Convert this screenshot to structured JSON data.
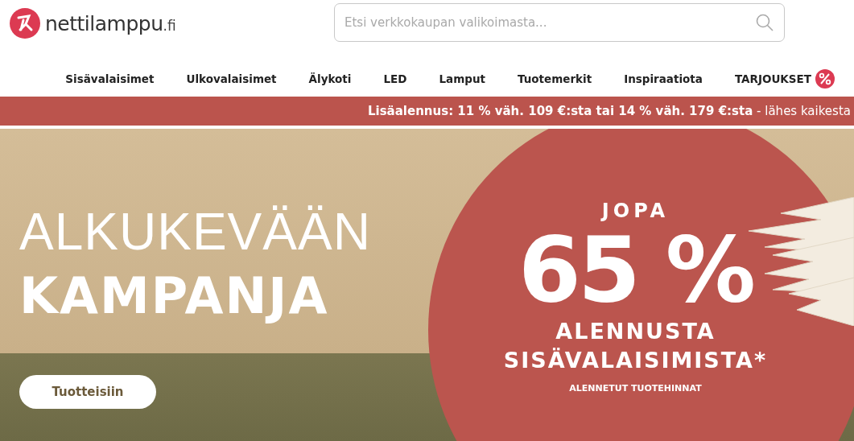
{
  "header": {
    "logo": {
      "name": "nettilamppu",
      "suffix": ".fi"
    },
    "search": {
      "placeholder": "Etsi verkkokaupan valikoimasta..."
    }
  },
  "nav": [
    {
      "label": "Sisävalaisimet",
      "kind": "link"
    },
    {
      "label": "Ulkovalaisimet",
      "kind": "link"
    },
    {
      "label": "Älykoti",
      "kind": "link"
    },
    {
      "label": "LED",
      "kind": "link"
    },
    {
      "label": "Lamput",
      "kind": "link"
    },
    {
      "label": "Tuotemerkit",
      "kind": "link"
    },
    {
      "label": "Inspiraatiota",
      "kind": "link"
    },
    {
      "label": "TARJOUKSET",
      "kind": "offers"
    }
  ],
  "promo_bar": {
    "text": "**Lisäalennus: 11 % väh. 109 €:sta tai 14 % väh. 179 €:sta** - lähes kaikesta"
  },
  "hero": {
    "title_light": "ALKUKEVÄÄN",
    "title_bold": "KAMPANJA",
    "button": "Tuotteisiin",
    "badge": {
      "lead": "JOPA",
      "figure": "65 %",
      "line_1": "ALENNUSTA",
      "line_2": "SISÄVALAISIMISTA*",
      "note": "ALENNETUT TUOTEHINNAT"
    }
  }
}
